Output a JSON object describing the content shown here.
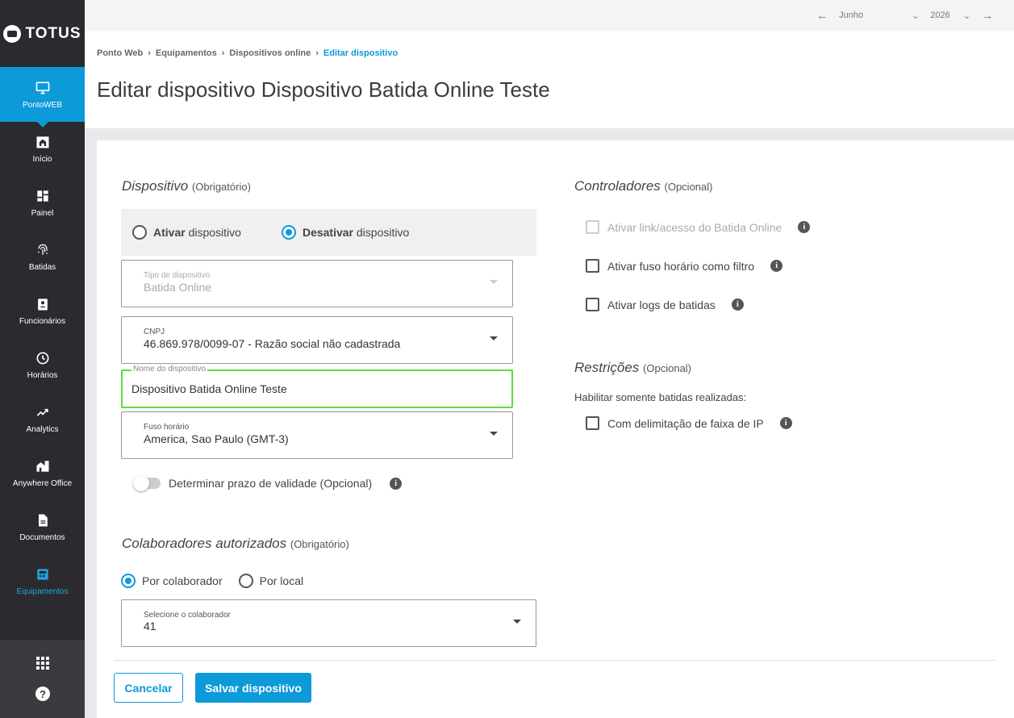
{
  "app": {
    "brand": "TOTUS"
  },
  "sidebar": {
    "module": "PontoWEB",
    "items": [
      {
        "label": "Início",
        "icon": "home-icon"
      },
      {
        "label": "Painel",
        "icon": "dashboard-icon"
      },
      {
        "label": "Batidas",
        "icon": "fingerprint-icon"
      },
      {
        "label": "Funcionários",
        "icon": "badge-icon"
      },
      {
        "label": "Horários",
        "icon": "clock-icon"
      },
      {
        "label": "Analytics",
        "icon": "trending-up-icon"
      },
      {
        "label": "Anywhere Office",
        "icon": "building-icon"
      },
      {
        "label": "Documentos",
        "icon": "document-icon"
      },
      {
        "label": "Equipamentos",
        "icon": "device-icon"
      }
    ]
  },
  "topbar": {
    "month": "Junho",
    "year": "2026"
  },
  "breadcrumb": [
    "Ponto Web",
    "Equipamentos",
    "Dispositivos online",
    "Editar dispositivo"
  ],
  "page": {
    "title": "Editar dispositivo Dispositivo Batida Online Teste"
  },
  "device": {
    "title": "Dispositivo",
    "title_note": "(Obrigatório)",
    "activate_bold": "Ativar",
    "activate_rest": "dispositivo",
    "deactivate_bold": "Desativar",
    "deactivate_rest": "dispositivo",
    "type_label": "Tipo de dispositivo",
    "type_value": "Batida Online",
    "cnpj_label": "CNPJ",
    "cnpj_value": "46.869.978/0099-07 - Razão social não cadastrada",
    "name_label": "Nome do dispositivo",
    "name_value": "Dispositivo Batida Online Teste",
    "tz_label": "Fuso horário",
    "tz_value": "America, Sao Paulo (GMT-3)",
    "validity_label": "Determinar prazo de validade (Opcional)"
  },
  "collaborators": {
    "title": "Colaboradores autorizados",
    "title_note": "(Obrigatório)",
    "by_collaborator": "Por colaborador",
    "by_location": "Por local",
    "select_label": "Selecione o colaborador",
    "select_value": "41"
  },
  "controllers": {
    "title": "Controladores",
    "title_note": "(Opcional)",
    "options": [
      "Ativar link/acesso do Batida Online",
      "Ativar fuso horário como filtro",
      "Ativar logs de batidas"
    ]
  },
  "restrictions": {
    "title": "Restrições",
    "title_note": "(Opcional)",
    "helper": "Habilitar somente batidas realizadas:",
    "option": "Com delimitação de faixa de IP"
  },
  "actions": {
    "cancel": "Cancelar",
    "save": "Salvar dispositivo"
  },
  "colors": {
    "accent": "#0c9ad8",
    "sidebar": "#2b2b2f",
    "focus": "#5fdd3a"
  }
}
